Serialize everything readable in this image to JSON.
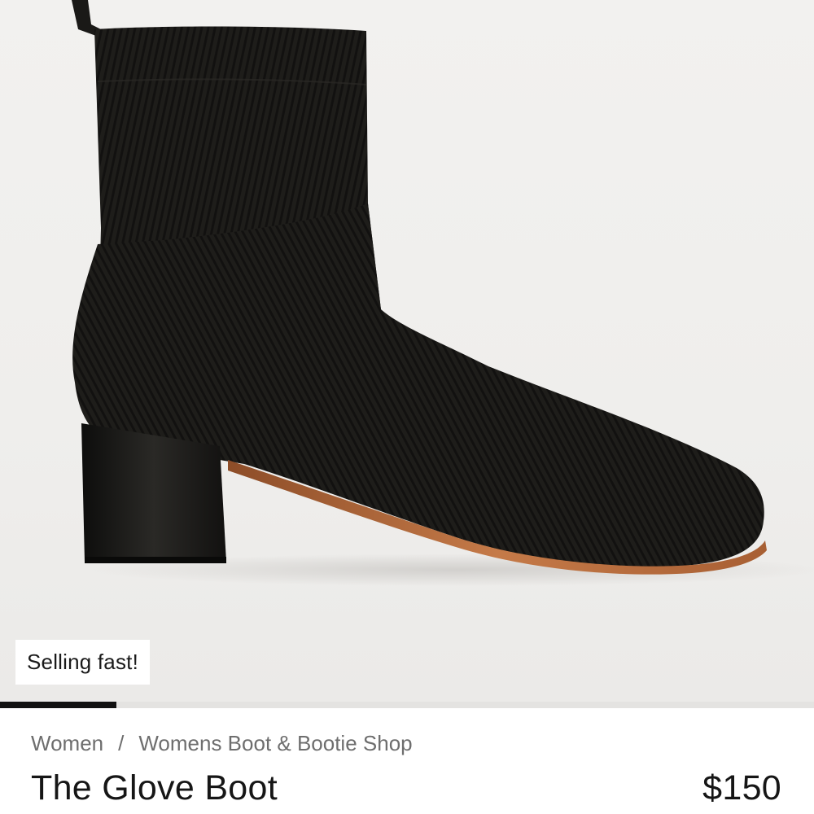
{
  "product_image": {
    "alt": "The Glove Boot",
    "badge": "Selling fast!"
  },
  "carousel": {
    "progress_fraction": 0.143
  },
  "breadcrumb": {
    "items": [
      "Women",
      "Womens Boot & Bootie Shop"
    ],
    "separator": "/"
  },
  "product": {
    "name": "The Glove Boot",
    "price": "$150"
  },
  "colors": {
    "boot": "#1d1c19",
    "sole": "#b5693a",
    "background": "#f0efed",
    "progress": "#111111"
  }
}
